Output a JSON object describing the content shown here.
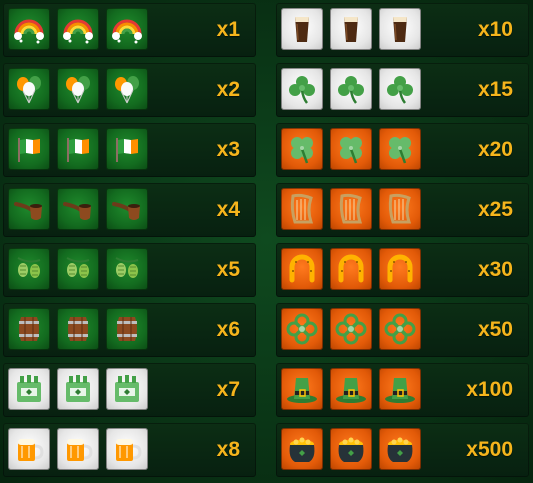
{
  "paytable": {
    "left": [
      {
        "symbol": "rainbow-icon",
        "tile": "green",
        "multiplier": "x1"
      },
      {
        "symbol": "balloons-icon",
        "tile": "green",
        "multiplier": "x2"
      },
      {
        "symbol": "irish-flag-icon",
        "tile": "green",
        "multiplier": "x3"
      },
      {
        "symbol": "pipe-icon",
        "tile": "green",
        "multiplier": "x4"
      },
      {
        "symbol": "hops-icon",
        "tile": "green",
        "multiplier": "x5"
      },
      {
        "symbol": "barrel-icon",
        "tile": "green",
        "multiplier": "x6"
      },
      {
        "symbol": "bottles-icon",
        "tile": "white",
        "multiplier": "x7"
      },
      {
        "symbol": "beer-mug-icon",
        "tile": "white",
        "multiplier": "x8"
      }
    ],
    "right": [
      {
        "symbol": "stout-glass-icon",
        "tile": "white",
        "multiplier": "x10"
      },
      {
        "symbol": "shamrock-icon",
        "tile": "white",
        "multiplier": "x15"
      },
      {
        "symbol": "four-leaf-clover-icon",
        "tile": "orange",
        "multiplier": "x20"
      },
      {
        "symbol": "harp-icon",
        "tile": "orange",
        "multiplier": "x25"
      },
      {
        "symbol": "horseshoe-icon",
        "tile": "orange",
        "multiplier": "x30"
      },
      {
        "symbol": "celtic-knot-icon",
        "tile": "orange",
        "multiplier": "x50"
      },
      {
        "symbol": "leprechaun-hat-icon",
        "tile": "orange",
        "multiplier": "x100"
      },
      {
        "symbol": "pot-of-gold-icon",
        "tile": "orange",
        "multiplier": "x500"
      }
    ]
  },
  "colors": {
    "background": "#0a3516",
    "multiplier_text": "#f5b51c",
    "tile_green": "#136b1f",
    "tile_white": "#e6e6e6",
    "tile_orange": "#e25a08"
  }
}
